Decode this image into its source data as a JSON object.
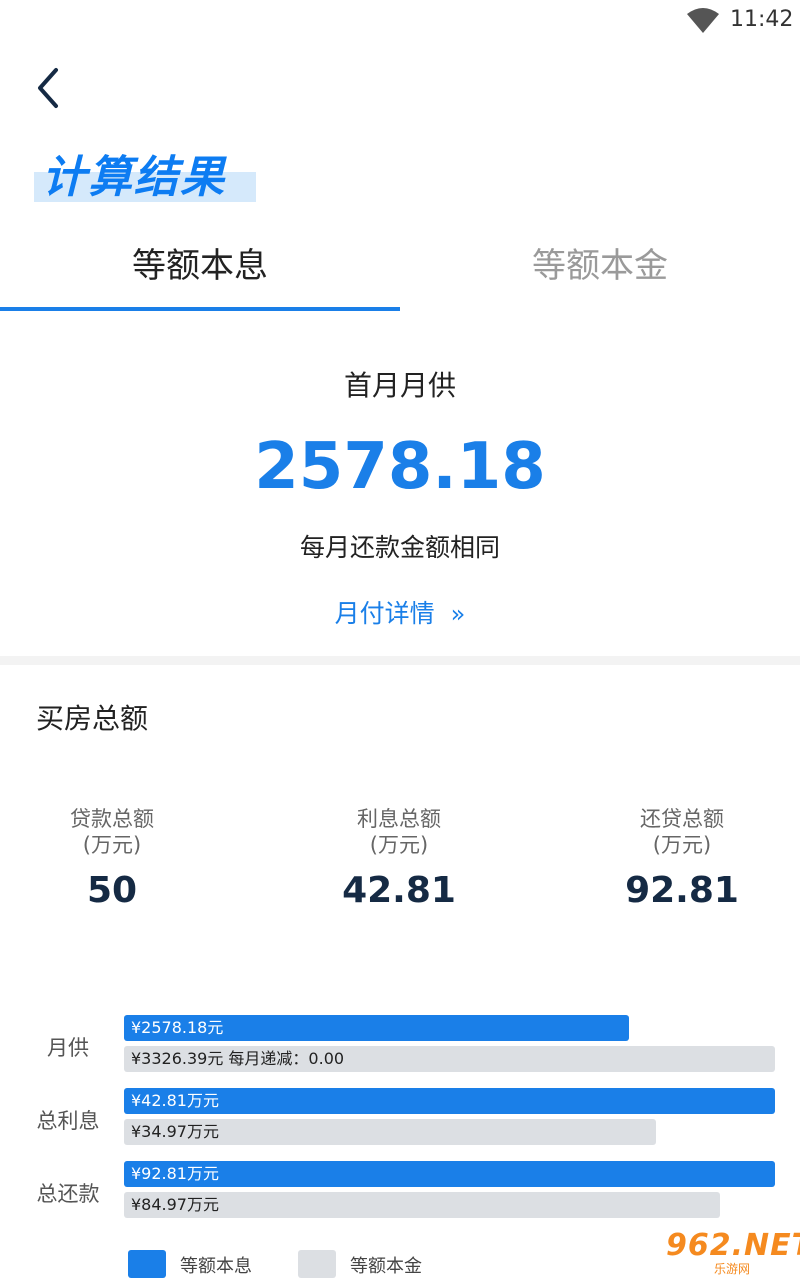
{
  "status_bar": {
    "time": "11:42"
  },
  "page": {
    "title": "计算结果"
  },
  "tabs": [
    {
      "label": "等额本息",
      "active": true
    },
    {
      "label": "等额本金",
      "active": false
    }
  ],
  "summary": {
    "label": "首月月供",
    "amount": "2578.18",
    "note": "每月还款金额相同",
    "detail_link": "月付详情",
    "detail_chevron": "»"
  },
  "section": {
    "title": "买房总额"
  },
  "stats": [
    {
      "label": "贷款总额",
      "unit": "(万元)",
      "value": "50"
    },
    {
      "label": "利息总额",
      "unit": "(万元)",
      "value": "42.81"
    },
    {
      "label": "还贷总额",
      "unit": "(万元)",
      "value": "92.81"
    }
  ],
  "chart_data": {
    "type": "bar",
    "orientation": "horizontal",
    "categories": [
      "月供",
      "总利息",
      "总还款"
    ],
    "series": [
      {
        "name": "等额本息",
        "color": "#1a7fe8",
        "values": [
          2578.18,
          42.81,
          92.81
        ],
        "labels": [
          "¥2578.18元",
          "¥42.81万元",
          "¥92.81万元"
        ],
        "fill_fraction": [
          0.775,
          1.0,
          1.0
        ]
      },
      {
        "name": "等额本金",
        "color": "#dcdfe3",
        "values": [
          3326.39,
          34.97,
          84.97
        ],
        "labels": [
          "¥3326.39元  每月递减：0.00",
          "¥34.97万元",
          "¥84.97万元"
        ],
        "fill_fraction": [
          1.0,
          0.817,
          0.916
        ]
      }
    ],
    "legend": "bottom"
  },
  "watermark": {
    "text": "962.NET",
    "sub": "乐游网"
  },
  "colors": {
    "accent": "#1a7fe8",
    "grey_bar": "#dcdfe3",
    "title_highlight": "#d5e9fb"
  }
}
